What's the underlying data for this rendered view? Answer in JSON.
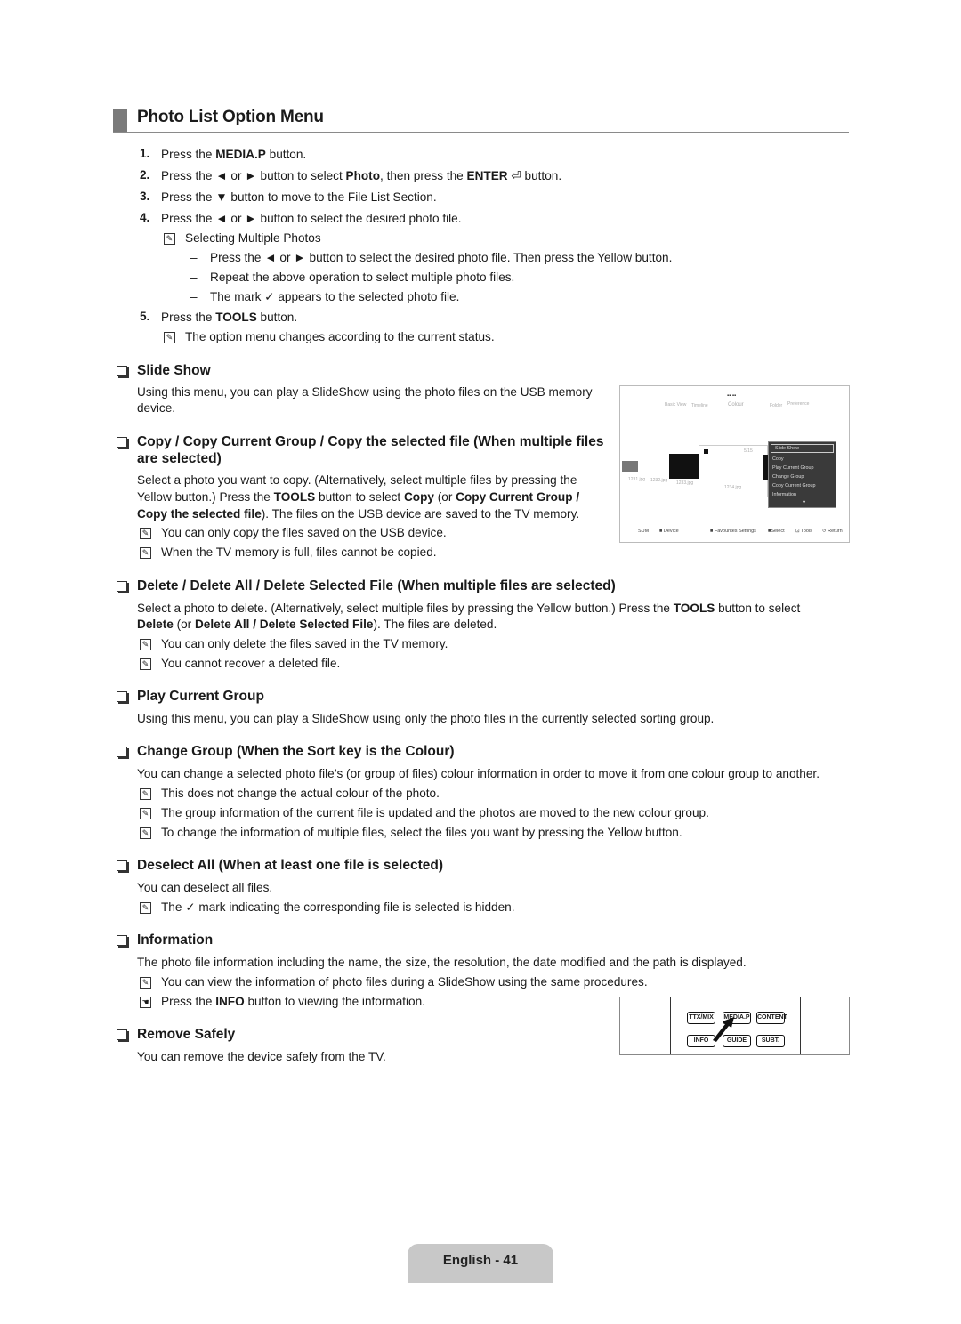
{
  "title": "Photo List Option Menu",
  "lines": [
    {
      "k": "num",
      "n": "1.",
      "s": [
        {
          "t": "Press the "
        },
        {
          "t": "MEDIA.P",
          "b": true
        },
        {
          "t": " button."
        }
      ]
    },
    {
      "k": "num",
      "n": "2.",
      "s": [
        {
          "t": "Press the ◄ or ► button to select "
        },
        {
          "t": "Photo",
          "b": true
        },
        {
          "t": ", then press the "
        },
        {
          "t": "ENTER",
          "b": true
        },
        {
          "t": " ⏎ button."
        }
      ]
    },
    {
      "k": "num",
      "n": "3.",
      "s": [
        {
          "t": "Press the ▼ button to move to the File List Section."
        }
      ]
    },
    {
      "k": "num",
      "n": "4.",
      "s": [
        {
          "t": "Press the ◄ or ► button to select the desired photo file."
        }
      ]
    },
    {
      "k": "note1",
      "s": [
        {
          "t": "Selecting Multiple Photos"
        }
      ]
    },
    {
      "k": "dash",
      "s": [
        {
          "t": "Press the ◄ or ► button to select the desired photo file. Then press the Yellow button."
        }
      ]
    },
    {
      "k": "dash",
      "s": [
        {
          "t": "Repeat the above operation to select multiple photo files."
        }
      ]
    },
    {
      "k": "dash",
      "s": [
        {
          "t": "The mark ✓ appears to the selected photo file."
        }
      ]
    },
    {
      "k": "num",
      "n": "5.",
      "s": [
        {
          "t": "Press the "
        },
        {
          "t": "TOOLS",
          "b": true
        },
        {
          "t": " button."
        }
      ]
    },
    {
      "k": "note1",
      "s": [
        {
          "t": "The option menu changes according to the current status."
        }
      ]
    },
    {
      "k": "h",
      "s": [
        {
          "t": "Slide Show"
        }
      ]
    },
    {
      "k": "p",
      "s": [
        {
          "t": "Using this menu, you can play a SlideShow using the photo files on the USB memory"
        }
      ]
    },
    {
      "k": "pc",
      "s": [
        {
          "t": "device."
        }
      ]
    },
    {
      "k": "h",
      "s": [
        {
          "t": "Copy / Copy Current Group / Copy the selected file (When multiple files"
        }
      ]
    },
    {
      "k": "hc",
      "s": [
        {
          "t": "are selected)"
        }
      ]
    },
    {
      "k": "p",
      "s": [
        {
          "t": "Select a photo you want to copy. (Alternatively, select multiple files by pressing the"
        }
      ]
    },
    {
      "k": "pc",
      "s": [
        {
          "t": "Yellow button.) Press the "
        },
        {
          "t": "TOOLS",
          "b": true
        },
        {
          "t": " button to select "
        },
        {
          "t": "Copy",
          "b": true
        },
        {
          "t": " (or "
        },
        {
          "t": "Copy Current Group /",
          "b": true
        }
      ]
    },
    {
      "k": "pc",
      "s": [
        {
          "t": "Copy the selected file",
          "b": true
        },
        {
          "t": "). The files on the USB device are saved to the TV memory."
        }
      ]
    },
    {
      "k": "note",
      "s": [
        {
          "t": "You can only copy the files saved on the USB device."
        }
      ]
    },
    {
      "k": "note",
      "s": [
        {
          "t": "When the TV memory is full, files cannot be copied."
        }
      ]
    },
    {
      "k": "h",
      "s": [
        {
          "t": "Delete / Delete All / Delete Selected File (When multiple files are selected)"
        }
      ]
    },
    {
      "k": "p",
      "s": [
        {
          "t": "Select a photo to delete. (Alternatively, select multiple files by pressing the Yellow button.) Press the "
        },
        {
          "t": "TOOLS",
          "b": true
        },
        {
          "t": " button to select"
        }
      ]
    },
    {
      "k": "pc",
      "s": [
        {
          "t": "Delete",
          "b": true
        },
        {
          "t": " (or "
        },
        {
          "t": "Delete All / Delete Selected File",
          "b": true
        },
        {
          "t": "). The files are deleted."
        }
      ]
    },
    {
      "k": "note",
      "s": [
        {
          "t": "You can only delete the files saved in the TV memory."
        }
      ]
    },
    {
      "k": "note",
      "s": [
        {
          "t": "You cannot recover a deleted file."
        }
      ]
    },
    {
      "k": "h",
      "s": [
        {
          "t": "Play Current Group"
        }
      ]
    },
    {
      "k": "p",
      "s": [
        {
          "t": "Using this menu, you can play a SlideShow using only the photo files in the currently selected sorting group."
        }
      ]
    },
    {
      "k": "h",
      "s": [
        {
          "t": "Change Group (When the Sort key is the Colour)"
        }
      ]
    },
    {
      "k": "p",
      "s": [
        {
          "t": "You can change a selected photo file’s (or group of files) colour information in order to move it from one colour group to another."
        }
      ]
    },
    {
      "k": "note",
      "s": [
        {
          "t": "This does not change the actual colour of the photo."
        }
      ]
    },
    {
      "k": "note",
      "s": [
        {
          "t": "The group information of the current file is updated and the photos are moved to the new colour group."
        }
      ]
    },
    {
      "k": "note",
      "s": [
        {
          "t": "To change the information of multiple files, select the files you want by pressing the Yellow button."
        }
      ]
    },
    {
      "k": "h",
      "s": [
        {
          "t": "Deselect All (When at least one file is selected)"
        }
      ]
    },
    {
      "k": "p",
      "s": [
        {
          "t": "You can deselect all files."
        }
      ]
    },
    {
      "k": "note",
      "s": [
        {
          "t": "The ✓ mark indicating the corresponding file is selected is hidden."
        }
      ]
    },
    {
      "k": "h",
      "s": [
        {
          "t": "Information"
        }
      ]
    },
    {
      "k": "p",
      "s": [
        {
          "t": "The photo file information including the name, the size, the resolution, the date modified and the path is displayed."
        }
      ]
    },
    {
      "k": "note",
      "s": [
        {
          "t": "You can view the information of photo files during a SlideShow using the same procedures."
        }
      ]
    },
    {
      "k": "hand",
      "s": [
        {
          "t": "Press the "
        },
        {
          "t": "INFO",
          "b": true
        },
        {
          "t": " button to viewing the information."
        }
      ]
    },
    {
      "k": "h",
      "s": [
        {
          "t": "Remove Safely"
        }
      ]
    },
    {
      "k": "p",
      "s": [
        {
          "t": "You can remove the device safely from the TV."
        }
      ]
    }
  ],
  "tv_screen": {
    "tabs": [
      "Basic View",
      "Timeline",
      "Colour",
      "Folder",
      "Preference"
    ],
    "counter": "5/15",
    "files": [
      "1231.jpg",
      "1232.jpg",
      "1233.jpg",
      "1234.jpg"
    ],
    "menu": [
      "Slide Show",
      "Copy",
      "Play Current Group",
      "Change Group",
      "Copy Current Group",
      "Information"
    ],
    "menu_more": "▼",
    "footer": {
      "device_name": "SUM",
      "device": "Device",
      "favourites": "Favourites Settings",
      "select": "Select",
      "tools": "Tools",
      "return": "Return"
    }
  },
  "remote": {
    "buttons": [
      "TTX/MIX",
      "MEDIA.P",
      "CONTENT",
      "INFO",
      "GUIDE",
      "SUBT."
    ]
  },
  "footer": {
    "page_label": "English - 41"
  }
}
